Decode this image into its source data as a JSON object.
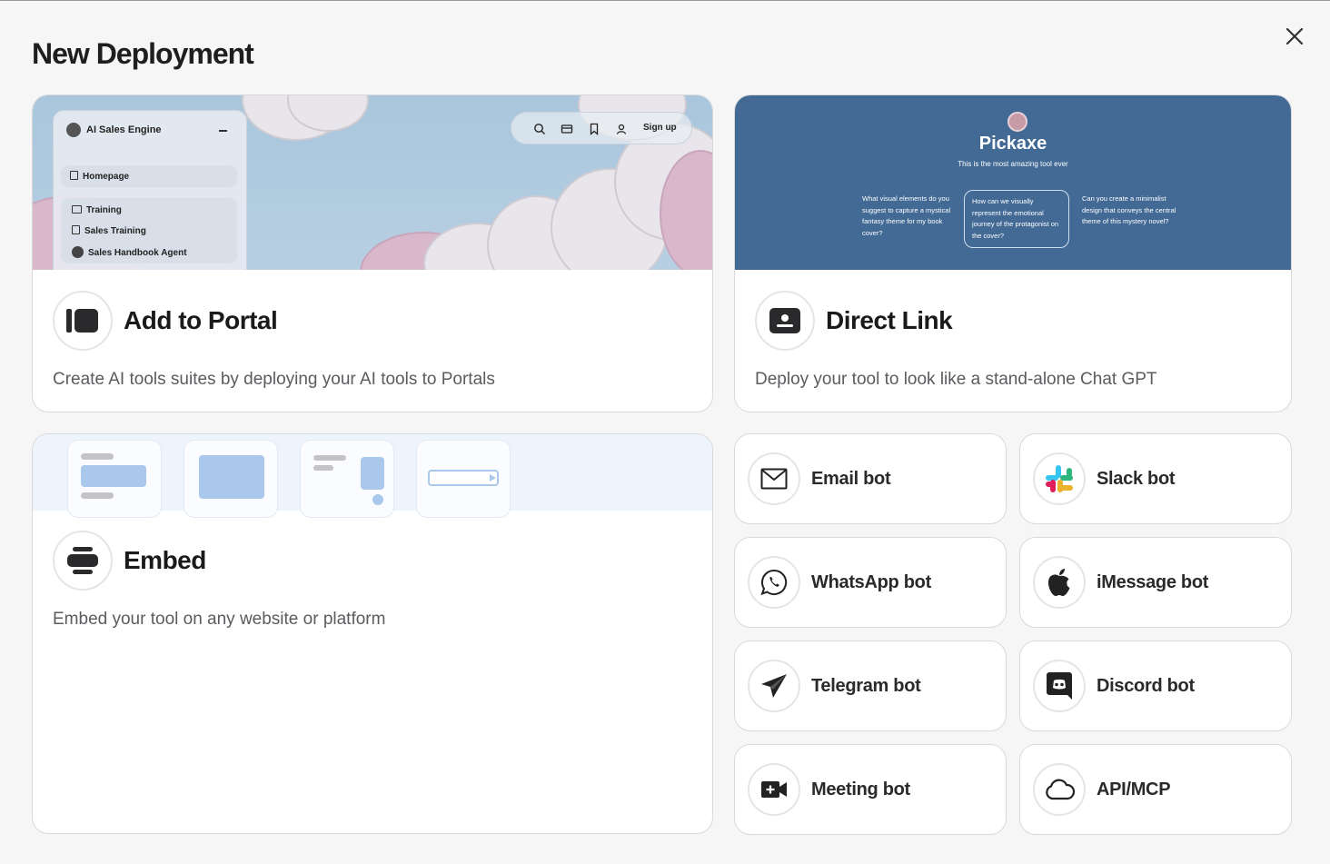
{
  "dialog": {
    "title": "New Deployment"
  },
  "portal": {
    "title": "Add to Portal",
    "description": "Create AI tools suites by deploying your AI tools to Portals",
    "preview": {
      "app_name": "AI Sales Engine",
      "items": [
        "Homepage",
        "Training",
        "Sales Training",
        "Sales Handbook Agent"
      ],
      "signup": "Sign up"
    }
  },
  "direct_link": {
    "title": "Direct Link",
    "description": "Deploy your tool to look like a stand-alone Chat GPT",
    "preview": {
      "name": "Pickaxe",
      "tagline": "This is the most amazing tool ever",
      "questions": [
        "What visual elements do you suggest to capture a mystical fantasy theme for my book cover?",
        "How can we visually represent the emotional journey of the protagonist on the cover?",
        "Can you create a minimalist design that conveys the central theme of this mystery novel?"
      ]
    }
  },
  "embed": {
    "title": "Embed",
    "description": "Embed your tool on any website or platform"
  },
  "bots": [
    {
      "label": "Email bot",
      "icon": "envelope-icon"
    },
    {
      "label": "Slack bot",
      "icon": "slack-icon"
    },
    {
      "label": "WhatsApp bot",
      "icon": "whatsapp-icon"
    },
    {
      "label": "iMessage bot",
      "icon": "apple-icon"
    },
    {
      "label": "Telegram bot",
      "icon": "paper-plane-icon"
    },
    {
      "label": "Discord bot",
      "icon": "discord-icon"
    },
    {
      "label": "Meeting bot",
      "icon": "video-camera-icon"
    },
    {
      "label": "API/MCP",
      "icon": "cloud-icon"
    }
  ],
  "colors": {
    "accent_blue": "#426a95",
    "embed_blue": "#a9c8eb"
  }
}
